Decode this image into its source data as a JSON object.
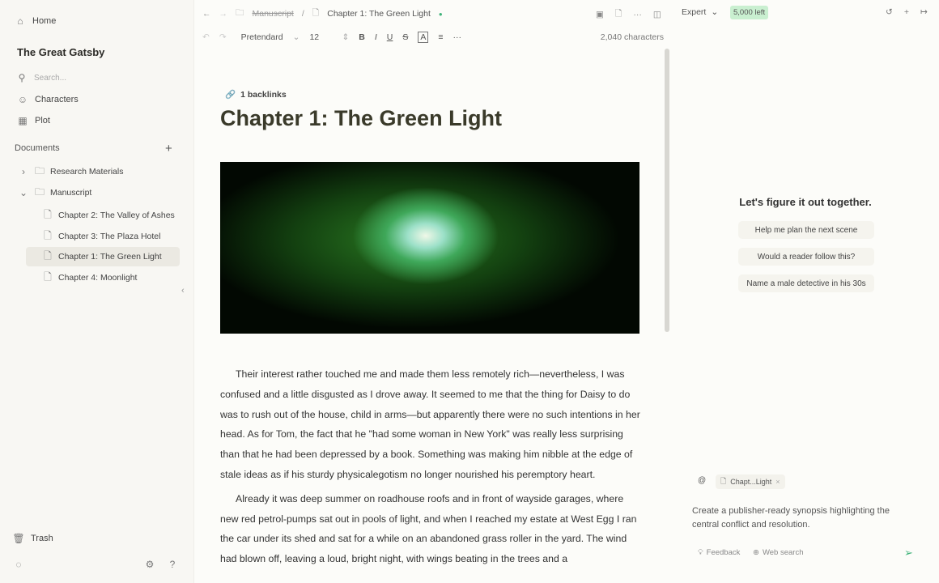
{
  "sidebar": {
    "home": "Home",
    "project_title": "The Great Gatsby",
    "search_placeholder": "Search...",
    "characters": "Characters",
    "plot": "Plot",
    "documents": "Documents",
    "tree": [
      {
        "label": "Research Materials"
      },
      {
        "label": "Manuscript"
      },
      {
        "label": "Chapter 2: The Valley of Ashes"
      },
      {
        "label": "Chapter 3: The Plaza Hotel"
      },
      {
        "label": "Chapter 1: The Green Light"
      },
      {
        "label": "Chapter 4: Moonlight"
      }
    ],
    "trash": "Trash"
  },
  "header": {
    "breadcrumb_parent": "Manuscript",
    "breadcrumb_current": "Chapter 1: The Green Light",
    "mode": "Expert",
    "credits": "5,000 left"
  },
  "toolbar": {
    "font": "Pretendard",
    "size": "12",
    "char_count": "2,040 characters"
  },
  "doc": {
    "backlinks": "1 backlinks",
    "title": "Chapter 1: The Green Light",
    "paragraphs": [
      "Their interest rather touched me and made them less remotely rich—nevertheless, I was confused and a little disgusted as I drove away. It seemed to me that the thing for Daisy to do was to rush out of the house, child in arms—but apparently there were no such intentions in her head. As for Tom, the fact that he \"had some woman in New York\" was really less surprising than that he had been depressed by a book. Something was making him nibble at the edge of stale ideas as if his sturdy physicalegotism no longer nourished his peremptory heart.",
      "Already it was deep summer on roadhouse roofs and in front of wayside garages, where new red petrol-pumps sat out in pools of light, and when I reached my estate at West Egg I ran the car under its shed and sat for a while on an abandoned grass roller in the yard. The wind had blown off, leaving a loud, bright night, with wings beating in the trees and a"
    ]
  },
  "assistant": {
    "heading": "Let's figure it out together.",
    "suggestions": [
      "Help me plan the next scene",
      "Would a reader follow this?",
      "Name a male detective in his 30s"
    ],
    "context_chip": "Chapt...Light",
    "prompt": "Create a publisher-ready synopsis highlighting the central conflict and resolution.",
    "feedback": "Feedback",
    "web_search": "Web search"
  },
  "colors": {
    "credits_bg": "#c9efd0",
    "accent": "#3fb37a"
  }
}
